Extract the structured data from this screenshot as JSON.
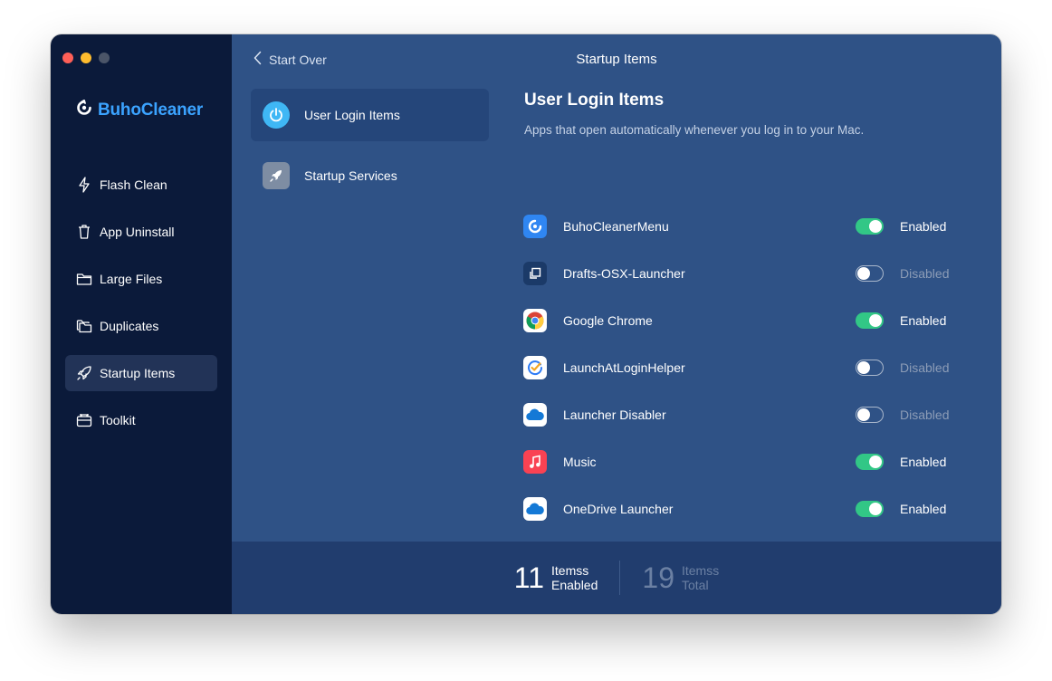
{
  "app": {
    "name": "BuhoCleaner"
  },
  "sidebar": {
    "items": [
      {
        "label": "Flash Clean",
        "icon": "lightning-icon"
      },
      {
        "label": "App Uninstall",
        "icon": "trash-icon"
      },
      {
        "label": "Large Files",
        "icon": "folder-icon"
      },
      {
        "label": "Duplicates",
        "icon": "duplicate-folders-icon"
      },
      {
        "label": "Startup Items",
        "icon": "rocket-icon",
        "active": true
      },
      {
        "label": "Toolkit",
        "icon": "toolbox-icon"
      }
    ]
  },
  "header": {
    "back_label": "Start Over",
    "title": "Startup Items"
  },
  "categories": [
    {
      "label": "User Login Items",
      "icon": "power-icon",
      "active": true
    },
    {
      "label": "Startup Services",
      "icon": "rocket-icon"
    }
  ],
  "section": {
    "title": "User Login Items",
    "description": "Apps that open automatically whenever you log in to your Mac."
  },
  "items": [
    {
      "name": "BuhoCleanerMenu",
      "icon": "buhocleaner-icon",
      "enabled": true,
      "status": "Enabled"
    },
    {
      "name": "Drafts-OSX-Launcher",
      "icon": "drafts-icon",
      "enabled": false,
      "status": "Disabled"
    },
    {
      "name": "Google Chrome",
      "icon": "chrome-icon",
      "enabled": true,
      "status": "Enabled"
    },
    {
      "name": "LaunchAtLoginHelper",
      "icon": "check-app-icon",
      "enabled": false,
      "status": "Disabled"
    },
    {
      "name": "Launcher Disabler",
      "icon": "cloud-icon",
      "enabled": false,
      "status": "Disabled"
    },
    {
      "name": "Music",
      "icon": "music-icon",
      "enabled": true,
      "status": "Enabled"
    },
    {
      "name": "OneDrive Launcher",
      "icon": "onedrive-icon",
      "enabled": true,
      "status": "Enabled"
    }
  ],
  "footer": {
    "enabled_count": "11",
    "enabled_label_1": "Itemss",
    "enabled_label_2": "Enabled",
    "total_count": "19",
    "total_label_1": "Itemss",
    "total_label_2": "Total"
  },
  "colors": {
    "sidebar_bg": "#0b1a3a",
    "main_bg": "#2f5286",
    "footer_bg": "#213d6e",
    "toggle_on": "#32c786",
    "logo": "#3ba3ff"
  }
}
